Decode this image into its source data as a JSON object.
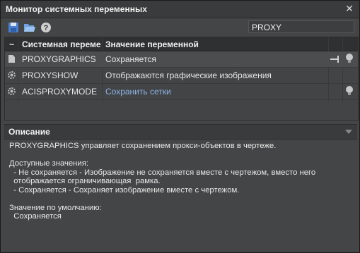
{
  "window": {
    "title": "Монитор системных переменных",
    "close_glyph": "✕"
  },
  "toolbar": {
    "search_value": "PROXY",
    "icons": [
      "save-icon",
      "open-folder-icon",
      "help-icon"
    ]
  },
  "table": {
    "headers": {
      "sort": "~",
      "name": "Системная переменная",
      "value": "Значение переменной"
    },
    "rows": [
      {
        "icon": "document-icon",
        "name": "PROXYGRAPHICS",
        "value": "Сохраняется",
        "pinned": true,
        "bulb": true
      },
      {
        "icon": "gear-icon",
        "name": "PROXYSHOW",
        "value": "Отображаются графические изображения",
        "pinned": false,
        "bulb": false
      },
      {
        "icon": "gear-icon",
        "name": "ACISPROXYMODE",
        "value": "Сохранить сетки",
        "pinned": false,
        "bulb": true
      }
    ]
  },
  "description": {
    "title": "Описание",
    "text": "PROXYGRAPHICS управляет сохранением прокси-объектов в чертеже.\n\nДоступные значения:\n  - Не сохраняется - Изображение не сохраняется вместе с чертежом, вместо него\n  отображается ограничивающая  рамка.\n  - Сохраняется - Сохраняет изображение вместе с чертежом.\n\nЗначение по умолчанию:\n  Сохраняется"
  },
  "colors": {
    "link": "#8fb4e8",
    "background": "#444546"
  }
}
